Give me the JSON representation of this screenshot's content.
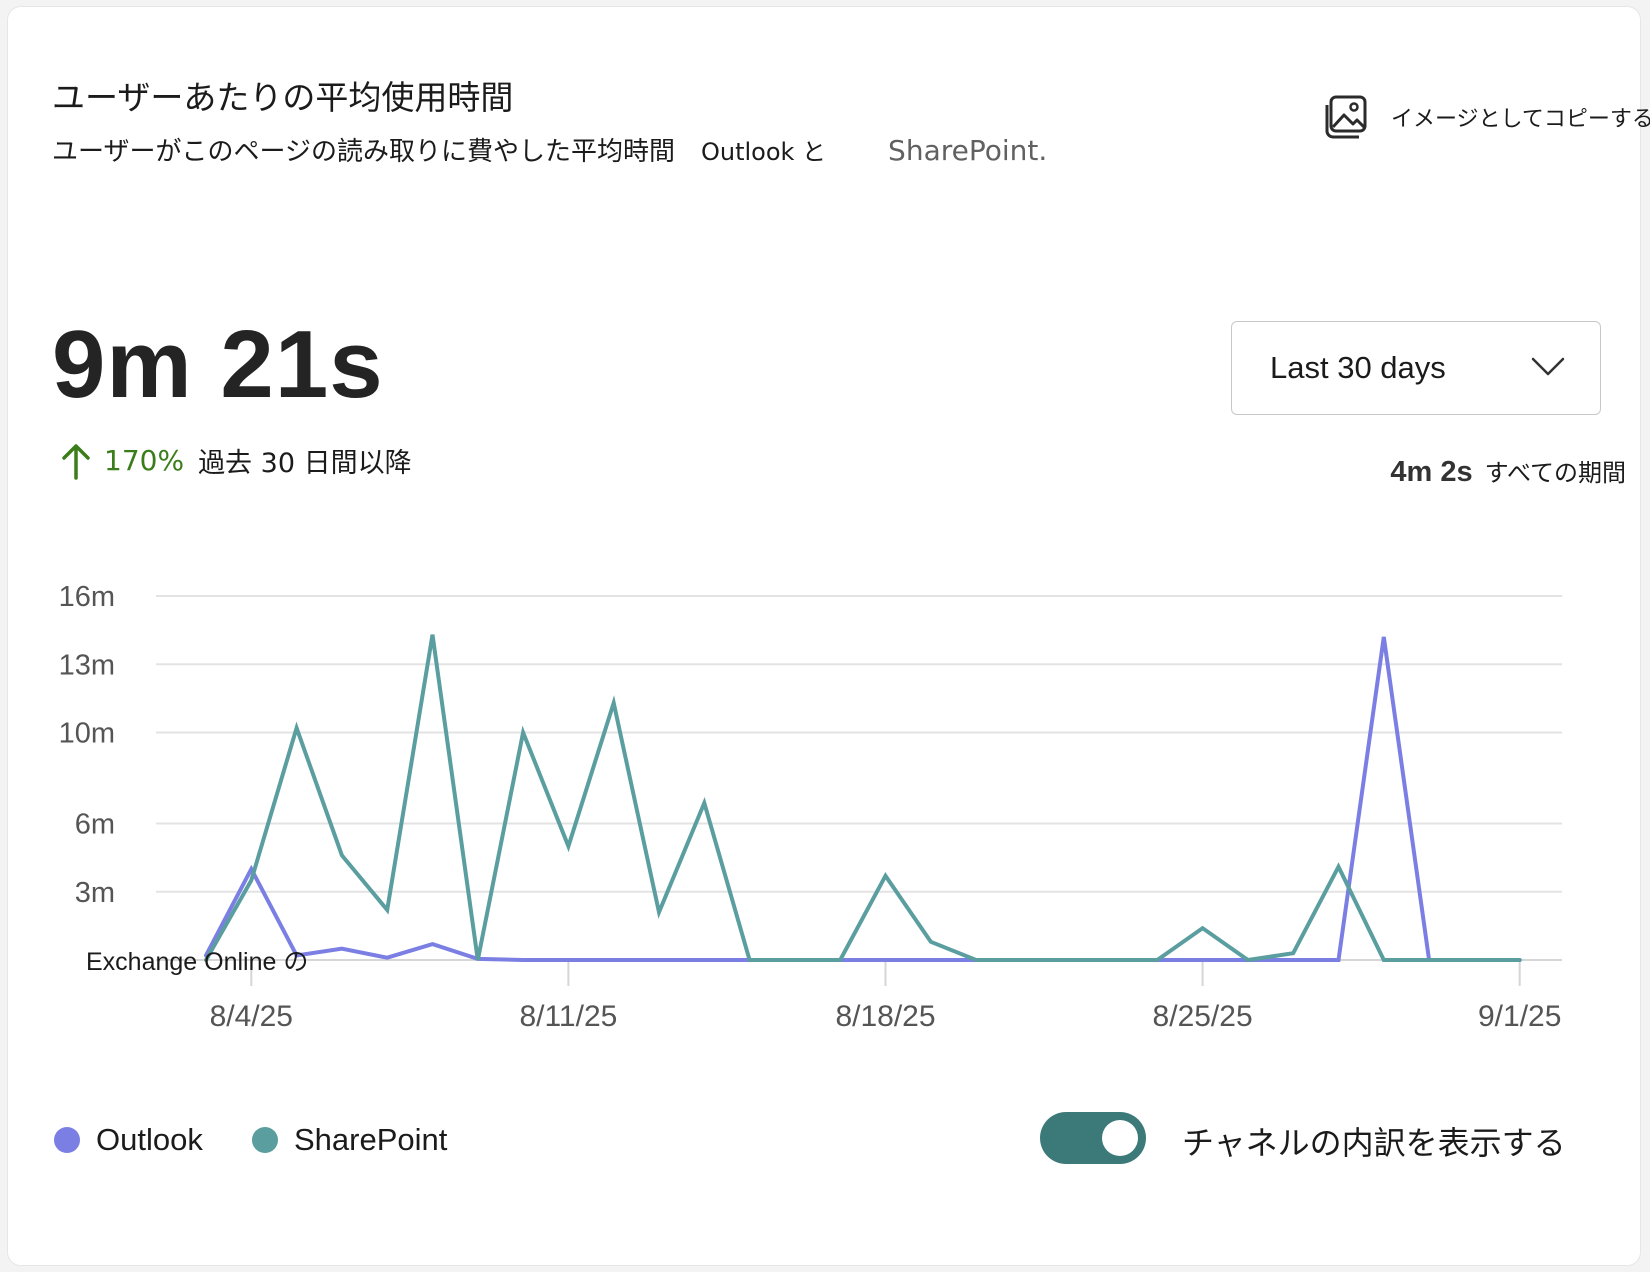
{
  "header": {
    "title": "ユーザーあたりの平均使用時間",
    "subtitle": "ユーザーがこのページの読み取りに費やした平均時間",
    "subtitle_outlook": "Outlook と",
    "subtitle_sharepoint": "SharePoint."
  },
  "copy_image": {
    "label": "イメージとしてコピーする",
    "icon": "copy-image-icon"
  },
  "summary": {
    "value": "9m 21s",
    "change_pct": "170%",
    "change_text": "過去 30 日間以降",
    "trend_icon": "arrow-up-icon",
    "trend_color": "#3a7d1a"
  },
  "range_select": {
    "selected": "Last 30 days",
    "icon": "chevron-down-icon"
  },
  "all_time": {
    "value": "4m 2s",
    "label": "すべての期間"
  },
  "chart_data": {
    "type": "line",
    "x_dates": [
      "8/3/25",
      "8/4/25",
      "8/5/25",
      "8/6/25",
      "8/7/25",
      "8/8/25",
      "8/9/25",
      "8/10/25",
      "8/11/25",
      "8/12/25",
      "8/13/25",
      "8/14/25",
      "8/15/25",
      "8/16/25",
      "8/17/25",
      "8/18/25",
      "8/19/25",
      "8/20/25",
      "8/21/25",
      "8/22/25",
      "8/23/25",
      "8/24/25",
      "8/25/25",
      "8/26/25",
      "8/27/25",
      "8/28/25",
      "8/29/25",
      "8/30/25",
      "8/31/25",
      "9/1/25"
    ],
    "x_tick_labels": [
      "8/4/25",
      "8/11/25",
      "8/18/25",
      "8/25/25",
      "9/1/25"
    ],
    "y_ticks": [
      3,
      6,
      10,
      13,
      16
    ],
    "y_tick_labels": [
      "3m",
      "6m",
      "10m",
      "13m",
      "16m"
    ],
    "ylim": [
      0,
      16
    ],
    "y_unit": "minutes",
    "overlay_label": "Exchange Online の",
    "series": [
      {
        "name": "Outlook",
        "color": "#7b7fe3",
        "values": [
          0.2,
          4.0,
          0.2,
          0.5,
          0.1,
          0.7,
          0.05,
          0,
          0,
          0,
          0,
          0,
          0,
          0,
          0,
          0,
          0,
          0,
          0,
          0,
          0,
          0,
          0,
          0,
          0,
          0,
          14.2,
          0,
          0,
          0
        ]
      },
      {
        "name": "SharePoint",
        "color": "#5b9ea0",
        "values": [
          0,
          3.5,
          10.2,
          4.6,
          2.2,
          14.3,
          0,
          10.0,
          5.0,
          11.3,
          2.1,
          6.9,
          0,
          0,
          0,
          3.7,
          0.8,
          0,
          0,
          0,
          0,
          0,
          1.4,
          0,
          0.3,
          4.1,
          0,
          0,
          0,
          0
        ]
      }
    ],
    "grid": true,
    "legend": "bottom-left"
  },
  "legend": [
    {
      "name": "Outlook",
      "color": "#7b7fe3"
    },
    {
      "name": "SharePoint",
      "color": "#5b9ea0"
    }
  ],
  "toggle": {
    "on": true,
    "label": "チャネルの内訳を表示する",
    "color": "#3c7a7a"
  }
}
